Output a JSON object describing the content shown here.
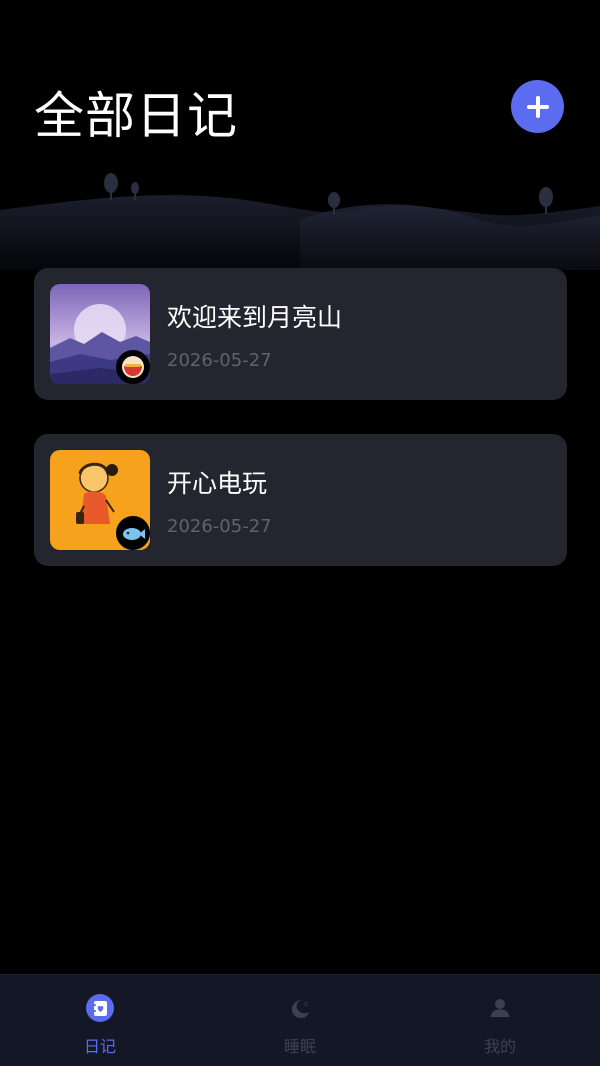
{
  "header": {
    "title": "全部日记",
    "add_icon": "plus-icon"
  },
  "entries": [
    {
      "title": "欢迎来到月亮山",
      "date": "2026-05-27",
      "thumbnail_icon": "moon-mountain-image",
      "mood_icon": "bowl-emoji-icon"
    },
    {
      "title": "开心电玩",
      "date": "2026-05-27",
      "thumbnail_icon": "gamer-girl-image",
      "mood_icon": "fish-emoji-icon"
    }
  ],
  "tabs": [
    {
      "label": "日记",
      "icon": "diary-heart-icon",
      "active": true
    },
    {
      "label": "睡眠",
      "icon": "moon-sleep-icon",
      "active": false
    },
    {
      "label": "我的",
      "icon": "user-icon",
      "active": false
    }
  ],
  "colors": {
    "accent": "#5b6cf0",
    "background": "#000000",
    "card": "#23262f",
    "date_text": "#5f6270",
    "tabbar": "#141826",
    "tab_inactive": "#3b4055"
  }
}
